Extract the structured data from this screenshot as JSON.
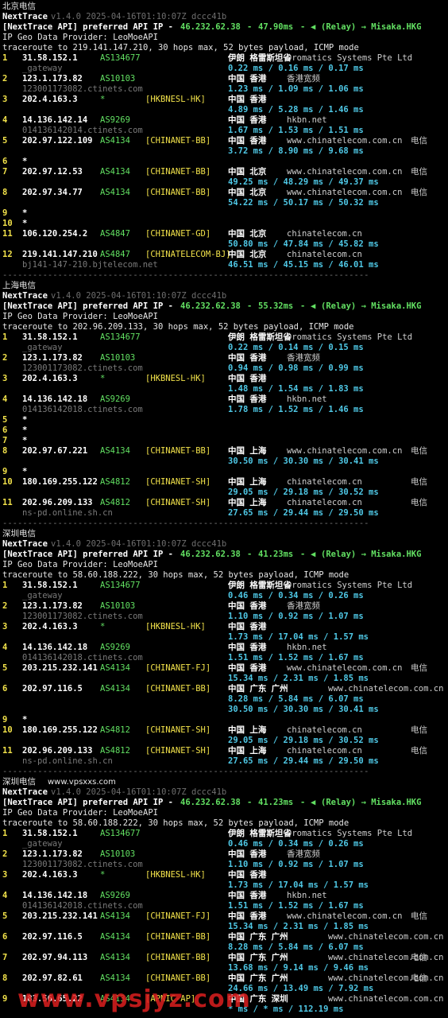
{
  "sections": [
    {
      "title": "北京电信",
      "app_name": "NextTrace",
      "version": "v1.4.0 2025-04-16T01:10:07Z dccc41b",
      "api_prefix": "[NextTrace API] preferred API IP - ",
      "api_ip": "46.232.62.38",
      "api_latency": "47.90ms",
      "api_relay": "(Relay) → Misaka.HKG",
      "provider": "IP Geo Data Provider: LeoMoeAPI",
      "traceroute": "traceroute to 219.141.147.210, 30 hops max, 52 bytes payload, ICMP mode",
      "hops": [
        {
          "n": "1",
          "ip": "31.58.152.1",
          "as": "AS134677",
          "tag": "",
          "geo": "伊朗 格雷斯坦省",
          "host": "Dromatics Systems Pte Ltd",
          "isp": "",
          "rdns": "_gateway",
          "lat": "0.22 ms / 0.16 ms / 0.17 ms"
        },
        {
          "n": "2",
          "ip": "123.1.173.82",
          "as": "AS10103",
          "tag": "",
          "geo": "中国 香港",
          "host": "香港宽频",
          "isp": "",
          "rdns": "123001173082.ctinets.com",
          "lat": "1.23 ms / 1.09 ms / 1.06 ms"
        },
        {
          "n": "3",
          "ip": "202.4.163.3",
          "as": "*",
          "tag": "[HKBNESL-HK]",
          "geo": "中国 香港",
          "host": "",
          "isp": "",
          "rdns": "",
          "lat": "4.89 ms / 5.28 ms / 1.46 ms"
        },
        {
          "n": "4",
          "ip": "14.136.142.14",
          "as": "AS9269",
          "tag": "",
          "geo": "中国 香港",
          "host": "hkbn.net",
          "isp": "",
          "rdns": "014136142014.ctinets.com",
          "lat": "1.67 ms / 1.53 ms / 1.51 ms"
        },
        {
          "n": "5",
          "ip": "202.97.122.109",
          "as": "AS4134",
          "tag": "[CHINANET-BB]",
          "geo": "中国 香港",
          "host": "www.chinatelecom.com.cn",
          "isp": "电信",
          "rdns": "",
          "lat": "3.72 ms / 8.90 ms / 9.68 ms"
        },
        {
          "n": "6",
          "ip": "*",
          "as": "",
          "tag": "",
          "geo": "",
          "host": "",
          "isp": "",
          "rdns": "",
          "lat": ""
        },
        {
          "n": "7",
          "ip": "202.97.12.53",
          "as": "AS4134",
          "tag": "[CHINANET-BB]",
          "geo": "中国 北京",
          "host": "www.chinatelecom.com.cn",
          "isp": "电信",
          "rdns": "",
          "lat": "49.25 ms / 48.29 ms / 49.37 ms"
        },
        {
          "n": "8",
          "ip": "202.97.34.77",
          "as": "AS4134",
          "tag": "[CHINANET-BB]",
          "geo": "中国 北京",
          "host": "www.chinatelecom.com.cn",
          "isp": "电信",
          "rdns": "",
          "lat": "54.22 ms / 50.17 ms / 50.32 ms"
        },
        {
          "n": "9",
          "ip": "*",
          "as": "",
          "tag": "",
          "geo": "",
          "host": "",
          "isp": "",
          "rdns": "",
          "lat": ""
        },
        {
          "n": "10",
          "ip": "*",
          "as": "",
          "tag": "",
          "geo": "",
          "host": "",
          "isp": "",
          "rdns": "",
          "lat": ""
        },
        {
          "n": "11",
          "ip": "106.120.254.2",
          "as": "AS4847",
          "tag": "[CHINANET-GD]",
          "geo": "中国 北京",
          "host": "chinatelecom.cn",
          "isp": "",
          "rdns": "",
          "lat": "50.80 ms / 47.84 ms / 45.82 ms"
        },
        {
          "n": "12",
          "ip": "219.141.147.210",
          "as": "AS4847",
          "tag": "[CHINATELECOM-BJ]",
          "geo": "中国 北京",
          "host": "chinatelecom.cn",
          "isp": "",
          "rdns": "bj141-147-210.bjtelecom.net",
          "lat": "46.51 ms / 45.15 ms / 46.01 ms"
        }
      ]
    },
    {
      "title": "上海电信",
      "app_name": "NextTrace",
      "version": "v1.4.0 2025-04-16T01:10:07Z dccc41b",
      "api_prefix": "[NextTrace API] preferred API IP - ",
      "api_ip": "46.232.62.38",
      "api_latency": "55.32ms",
      "api_relay": "(Relay) → Misaka.HKG",
      "provider": "IP Geo Data Provider: LeoMoeAPI",
      "traceroute": "traceroute to 202.96.209.133, 30 hops max, 52 bytes payload, ICMP mode",
      "hops": [
        {
          "n": "1",
          "ip": "31.58.152.1",
          "as": "AS134677",
          "tag": "",
          "geo": "伊朗 格雷斯坦省",
          "host": "Dromatics Systems Pte Ltd",
          "isp": "",
          "rdns": "_gateway",
          "lat": "0.22 ms / 0.14 ms / 0.15 ms"
        },
        {
          "n": "2",
          "ip": "123.1.173.82",
          "as": "AS10103",
          "tag": "",
          "geo": "中国 香港",
          "host": "香港宽频",
          "isp": "",
          "rdns": "123001173082.ctinets.com",
          "lat": "0.94 ms / 0.98 ms / 0.99 ms"
        },
        {
          "n": "3",
          "ip": "202.4.163.3",
          "as": "*",
          "tag": "[HKBNESL-HK]",
          "geo": "中国 香港",
          "host": "",
          "isp": "",
          "rdns": "",
          "lat": "1.48 ms / 1.54 ms / 1.83 ms"
        },
        {
          "n": "4",
          "ip": "14.136.142.18",
          "as": "AS9269",
          "tag": "",
          "geo": "中国 香港",
          "host": "hkbn.net",
          "isp": "",
          "rdns": "014136142018.ctinets.com",
          "lat": "1.78 ms / 1.52 ms / 1.46 ms"
        },
        {
          "n": "5",
          "ip": "*",
          "as": "",
          "tag": "",
          "geo": "",
          "host": "",
          "isp": "",
          "rdns": "",
          "lat": ""
        },
        {
          "n": "6",
          "ip": "*",
          "as": "",
          "tag": "",
          "geo": "",
          "host": "",
          "isp": "",
          "rdns": "",
          "lat": ""
        },
        {
          "n": "7",
          "ip": "*",
          "as": "",
          "tag": "",
          "geo": "",
          "host": "",
          "isp": "",
          "rdns": "",
          "lat": ""
        },
        {
          "n": "8",
          "ip": "202.97.67.221",
          "as": "AS4134",
          "tag": "[CHINANET-BB]",
          "geo": "中国 上海",
          "host": "www.chinatelecom.com.cn",
          "isp": "电信",
          "rdns": "",
          "lat": "30.50 ms / 30.30 ms / 30.41 ms"
        },
        {
          "n": "9",
          "ip": "*",
          "as": "",
          "tag": "",
          "geo": "",
          "host": "",
          "isp": "",
          "rdns": "",
          "lat": ""
        },
        {
          "n": "10",
          "ip": "180.169.255.122",
          "as": "AS4812",
          "tag": "[CHINANET-SH]",
          "geo": "中国 上海",
          "host": "chinatelecom.cn",
          "isp": "电信",
          "rdns": "",
          "lat": "29.05 ms / 29.18 ms / 30.52 ms"
        },
        {
          "n": "11",
          "ip": "202.96.209.133",
          "as": "AS4812",
          "tag": "[CHINANET-SH]",
          "geo": "中国 上海",
          "host": "chinatelecom.cn",
          "isp": "电信",
          "rdns": "ns-pd.online.sh.cn",
          "lat": "27.65 ms / 29.44 ms / 29.50 ms"
        }
      ]
    },
    {
      "title": "深圳电信",
      "app_name": "NextTrace",
      "version": "v1.4.0 2025-04-16T01:10:07Z dccc41b",
      "api_prefix": "[NextTrace API] preferred API IP - ",
      "api_ip": "46.232.62.38",
      "api_latency": "41.23ms",
      "api_relay": "(Relay) → Misaka.HKG",
      "provider": "IP Geo Data Provider: LeoMoeAPI",
      "traceroute": "traceroute to 58.60.188.222, 30 hops max, 52 bytes payload, ICMP mode",
      "hops": [
        {
          "n": "1",
          "ip": "31.58.152.1",
          "as": "AS134677",
          "tag": "",
          "geo": "伊朗 格雷斯坦省",
          "host": "Dromatics Systems Pte Ltd",
          "isp": "",
          "rdns": "_gateway",
          "lat": "0.46 ms / 0.34 ms / 0.26 ms"
        },
        {
          "n": "2",
          "ip": "123.1.173.82",
          "as": "AS10103",
          "tag": "",
          "geo": "中国 香港",
          "host": "香港宽频",
          "isp": "",
          "rdns": "123001173082.ctinets.com",
          "lat": "1.10 ms / 0.92 ms / 1.07 ms"
        },
        {
          "n": "3",
          "ip": "202.4.163.3",
          "as": "*",
          "tag": "[HKBNESL-HK]",
          "geo": "中国 香港",
          "host": "",
          "isp": "",
          "rdns": "",
          "lat": "1.73 ms / 17.04 ms / 1.57 ms"
        },
        {
          "n": "4",
          "ip": "14.136.142.18",
          "as": "AS9269",
          "tag": "",
          "geo": "中国 香港",
          "host": "hkbn.net",
          "isp": "",
          "rdns": "014136142018.ctinets.com",
          "lat": "1.51 ms / 1.52 ms / 1.67 ms"
        },
        {
          "n": "5",
          "ip": "203.215.232.141",
          "as": "AS4134",
          "tag": "[CHINANET-FJ]",
          "geo": "中国 香港",
          "host": "www.chinatelecom.com.cn",
          "isp": "电信",
          "rdns": "",
          "lat": "15.34 ms / 2.31 ms / 1.85 ms"
        },
        {
          "n": "6",
          "ip": "202.97.116.5",
          "as": "AS4134",
          "tag": "[CHINANET-BB]",
          "geo": "中国 广东 广州",
          "host": "www.chinatelecom.com.cn",
          "isp": "",
          "rdns": "",
          "lat": "8.28 ms / 5.84 ms / 6.07 ms",
          "lat2": "30.50 ms / 30.30 ms / 30.41 ms"
        },
        {
          "n": "9",
          "ip": "*",
          "as": "",
          "tag": "",
          "geo": "",
          "host": "",
          "isp": "",
          "rdns": "",
          "lat": ""
        },
        {
          "n": "10",
          "ip": "180.169.255.122",
          "as": "AS4812",
          "tag": "[CHINANET-SH]",
          "geo": "中国 上海",
          "host": "chinatelecom.cn",
          "isp": "电信",
          "rdns": "",
          "lat": "29.05 ms / 29.18 ms / 30.52 ms"
        },
        {
          "n": "11",
          "ip": "202.96.209.133",
          "as": "AS4812",
          "tag": "[CHINANET-SH]",
          "geo": "中国 上海",
          "host": "chinatelecom.cn",
          "isp": "电信",
          "rdns": "ns-pd.online.sh.cn",
          "lat": "27.65 ms / 29.44 ms / 29.50 ms"
        }
      ]
    },
    {
      "title": "深圳电信",
      "title_watermark": "www.vpsxxs.com",
      "app_name": "NextTrace",
      "version": "v1.4.0 2025-04-16T01:10:07Z dccc41b",
      "api_prefix": "[NextTrace API] preferred API IP - ",
      "api_ip": "46.232.62.38",
      "api_latency": "41.23ms",
      "api_relay": "(Relay) → Misaka.HKG",
      "provider": "IP Geo Data Provider: LeoMoeAPI",
      "traceroute": "traceroute to 58.60.188.222, 30 hops max, 52 bytes payload, ICMP mode",
      "hops": [
        {
          "n": "1",
          "ip": "31.58.152.1",
          "as": "AS134677",
          "tag": "",
          "geo": "伊朗 格雷斯坦省",
          "host": "Dromatics Systems Pte Ltd",
          "isp": "",
          "rdns": "_gateway",
          "lat": "0.46 ms / 0.34 ms / 0.26 ms"
        },
        {
          "n": "2",
          "ip": "123.1.173.82",
          "as": "AS10103",
          "tag": "",
          "geo": "中国 香港",
          "host": "香港宽频",
          "isp": "",
          "rdns": "123001173082.ctinets.com",
          "lat": "1.10 ms / 0.92 ms / 1.07 ms"
        },
        {
          "n": "3",
          "ip": "202.4.163.3",
          "as": "*",
          "tag": "[HKBNESL-HK]",
          "geo": "中国 香港",
          "host": "",
          "isp": "",
          "rdns": "",
          "lat": "1.73 ms / 17.04 ms / 1.57 ms"
        },
        {
          "n": "4",
          "ip": "14.136.142.18",
          "as": "AS9269",
          "tag": "",
          "geo": "中国 香港",
          "host": "hkbn.net",
          "isp": "",
          "rdns": "014136142018.ctinets.com",
          "lat": "1.51 ms / 1.52 ms / 1.67 ms"
        },
        {
          "n": "5",
          "ip": "203.215.232.141",
          "as": "AS4134",
          "tag": "[CHINANET-FJ]",
          "geo": "中国 香港",
          "host": "www.chinatelecom.com.cn",
          "isp": "电信",
          "rdns": "",
          "lat": "15.34 ms / 2.31 ms / 1.85 ms"
        },
        {
          "n": "6",
          "ip": "202.97.116.5",
          "as": "AS4134",
          "tag": "[CHINANET-BB]",
          "geo": "中国 广东 广州",
          "host": "www.chinatelecom.com.cn",
          "isp": "",
          "rdns": "",
          "lat": "8.28 ms / 5.84 ms / 6.07 ms"
        },
        {
          "n": "7",
          "ip": "202.97.94.113",
          "as": "AS4134",
          "tag": "[CHINANET-BB]",
          "geo": "中国 广东 广州",
          "host": "www.chinatelecom.com.cn",
          "isp": "电信",
          "rdns": "",
          "lat": "13.68 ms / 9.14 ms / 9.46 ms"
        },
        {
          "n": "8",
          "ip": "202.97.82.61",
          "as": "AS4134",
          "tag": "[CHINANET-BB]",
          "geo": "中国 广东 广州",
          "host": "www.chinatelecom.com.cn",
          "isp": "电信",
          "rdns": "",
          "lat": "24.66 ms / 13.49 ms / 7.92 ms"
        },
        {
          "n": "9",
          "ip": "183.56.65.22",
          "as": "AS4134",
          "tag": "[APNIC-AP]",
          "geo": "中国 广东 深圳",
          "host": "www.chinatelecom.com.cn",
          "isp": "",
          "rdns": "",
          "lat": "* ms / * ms / 112.19 ms"
        }
      ]
    }
  ],
  "separator": "-------------------------------------------------------------------------",
  "watermark": "www.vpsjyz.com",
  "relay_icon": "relay-arrow-icon",
  "colors": {
    "latency": "#4fc8e6",
    "as": "#62e062",
    "index": "#f2e24a",
    "background": "#000000",
    "watermark": "#dc1e1e"
  }
}
